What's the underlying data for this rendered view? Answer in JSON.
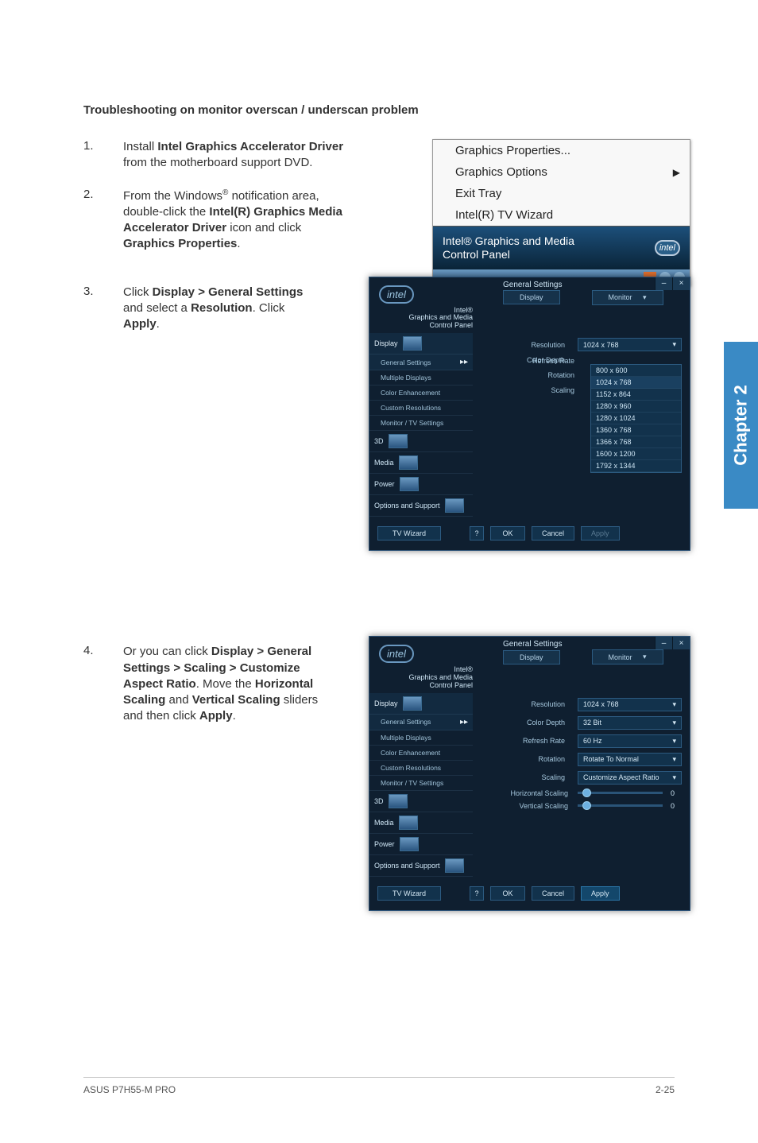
{
  "heading": "Troubleshooting on monitor overscan / underscan problem",
  "steps": {
    "s1": {
      "num": "1.",
      "t1": "Install ",
      "t2_bold": "Intel Graphics Accelerator Driver",
      "t3": " from the motherboard support DVD."
    },
    "s2": {
      "num": "2.",
      "t1": "From the Windows",
      "sup": "®",
      "t2": " notification area, double-click the ",
      "t3_bold": "Intel(R) Graphics Media Accelerator Driver",
      "t4": " icon and click ",
      "t5_bold": "Graphics Properties",
      "t6": "."
    },
    "s3": {
      "num": "3.",
      "t1": "Click ",
      "t2_bold": "Display > General Settings",
      "t3": " and select a ",
      "t4_bold": "Resolution",
      "t5": ". Click ",
      "t6_bold": "Apply",
      "t7": "."
    },
    "s4": {
      "num": "4.",
      "t1": "Or you can click ",
      "t2_bold": "Display > General Settings > Scaling > Customize Aspect Ratio",
      "t3": ". Move the ",
      "t4_bold": "Horizontal Scaling",
      "t5": " and ",
      "t6_bold": "Vertical Scaling",
      "t7": " sliders and then click ",
      "t8_bold": "Apply",
      "t9": "."
    }
  },
  "context_menu": {
    "items": {
      "i1": "Graphics Properties...",
      "i2": "Graphics Options",
      "i3": "Exit Tray",
      "i4": "Intel(R) TV Wizard"
    },
    "bar_line1": "Intel® Graphics and Media",
    "bar_line2": "Control Panel",
    "logo": "intel"
  },
  "panel_common": {
    "brand_logo": "intel",
    "brand_l1": "Intel®",
    "brand_l2": "Graphics and Media",
    "brand_l3": "Control Panel",
    "crumb": "General Settings",
    "tab_display": "Display",
    "tab_monitor": "Monitor",
    "side": {
      "display": "Display",
      "general": "General Settings",
      "multiple": "Multiple Displays",
      "color": "Color Enhancement",
      "custom": "Custom Resolutions",
      "monitor_tv": "Monitor / TV Settings",
      "sd": "3D",
      "media": "Media",
      "power": "Power",
      "options": "Options and Support"
    },
    "labels": {
      "resolution": "Resolution",
      "color_depth": "Color Depth",
      "refresh": "Refresh Rate",
      "rotation": "Rotation",
      "scaling": "Scaling",
      "hscale": "Horizontal Scaling",
      "vscale": "Vertical Scaling"
    },
    "tvwizard": "TV Wizard",
    "help": "?",
    "ok": "OK",
    "cancel": "Cancel",
    "apply": "Apply",
    "min": "–",
    "close": "×"
  },
  "panel3": {
    "resolution": "1024 x 768",
    "res_options": {
      "r1": "800 x 600",
      "r2": "1024 x 768",
      "r3": "1152 x 864",
      "r4": "1280 x 960",
      "r5": "1280 x 1024",
      "r6": "1360 x 768",
      "r7": "1366 x 768",
      "r8": "1600 x 1200",
      "r9": "1792 x 1344"
    }
  },
  "panel4": {
    "resolution": "1024 x 768",
    "color_depth": "32 Bit",
    "refresh": "60 Hz",
    "rotation": "Rotate To Normal",
    "scaling": "Customize Aspect Ratio",
    "hval": "0",
    "vval": "0"
  },
  "side_tab": "Chapter 2",
  "footer_left": "ASUS P7H55-M PRO",
  "footer_right": "2-25"
}
